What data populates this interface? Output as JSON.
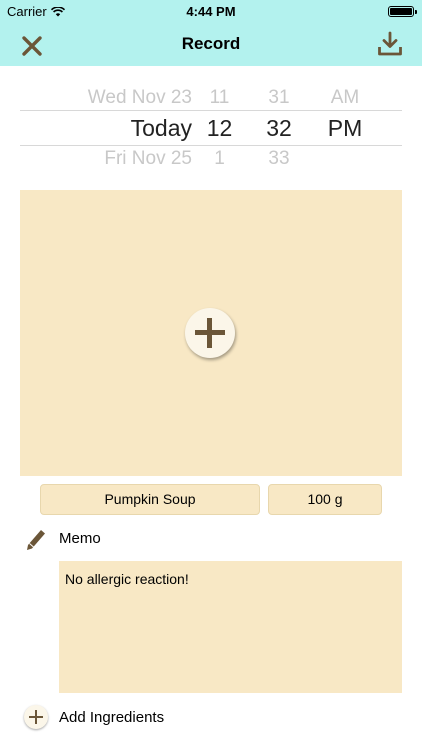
{
  "status_bar": {
    "carrier": "Carrier",
    "time": "4:44 PM"
  },
  "nav": {
    "title": "Record",
    "close_icon": "close-icon",
    "save_icon": "download-icon",
    "bg_color": "#b3f2ee"
  },
  "picker": {
    "top": [
      "Wed Nov 23",
      "11",
      "31",
      "AM"
    ],
    "selected": [
      "Today",
      "12",
      "32",
      "PM"
    ],
    "bottom": [
      "Fri Nov 25",
      "1",
      "33",
      ""
    ]
  },
  "photo": {
    "add_icon": "plus-circle-icon",
    "bg_color": "#f8e8c5"
  },
  "food": {
    "name": "Pumpkin Soup",
    "amount": "100 g"
  },
  "memo": {
    "label": "Memo",
    "icon": "pencil-icon",
    "text": "No allergic reaction!"
  },
  "ingredients": {
    "add_label": "Add Ingredients",
    "icon": "plus-circle-icon"
  }
}
